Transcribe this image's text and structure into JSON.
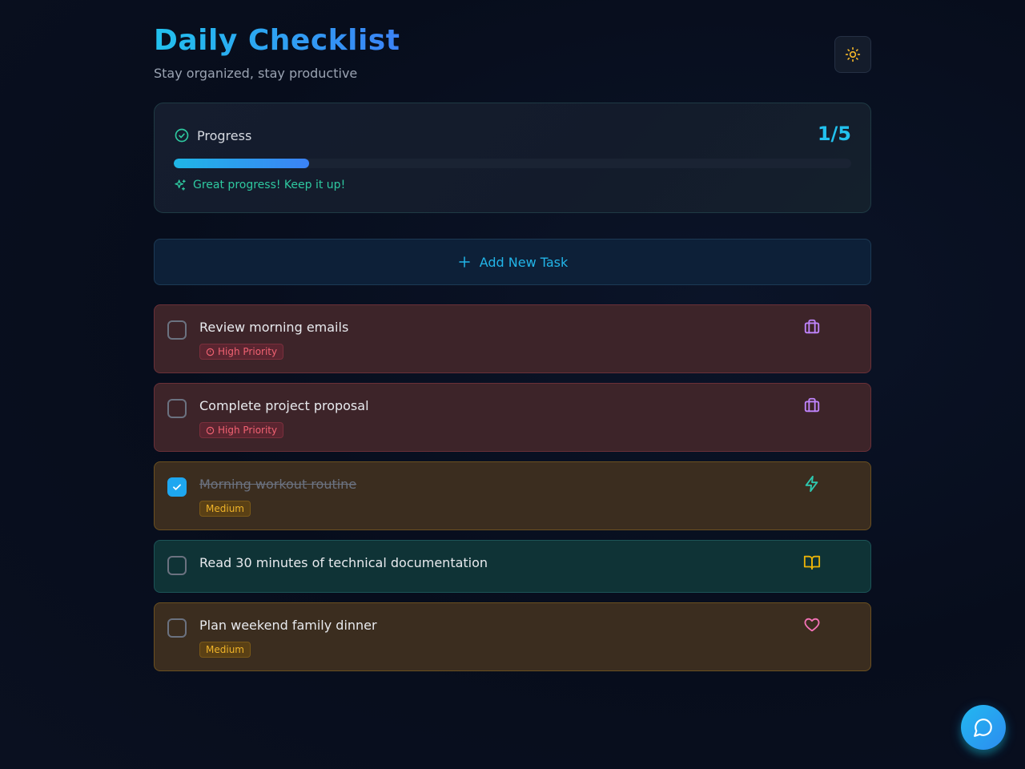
{
  "header": {
    "title": "Daily Checklist",
    "subtitle": "Stay organized, stay productive",
    "theme_toggle_icon": "sun-icon"
  },
  "progress": {
    "label": "Progress",
    "count": "1/5",
    "completed": 1,
    "total": 5,
    "fraction": 0.2,
    "message": "Great progress! Keep it up!"
  },
  "add_task": {
    "label": "Add New Task"
  },
  "tasks": [
    {
      "title": "Review morning emails",
      "priority": "High Priority",
      "category_icon": "briefcase-icon",
      "completed": false
    },
    {
      "title": "Complete project proposal",
      "priority": "High Priority",
      "category_icon": "briefcase-icon",
      "completed": false
    },
    {
      "title": "Morning workout routine",
      "priority": "Medium",
      "category_icon": "lightning-icon",
      "completed": true
    },
    {
      "title": "Read 30 minutes of technical documentation",
      "priority": "",
      "category_icon": "book-icon",
      "completed": false
    },
    {
      "title": "Plan weekend family dinner",
      "priority": "Medium",
      "category_icon": "heart-icon",
      "completed": false
    }
  ],
  "colors": {
    "accent": "#22c1ee",
    "high": "#f06272",
    "medium": "#f0b429",
    "success": "#2ec9a0"
  },
  "chat_button_icon": "chat-bubble-icon"
}
